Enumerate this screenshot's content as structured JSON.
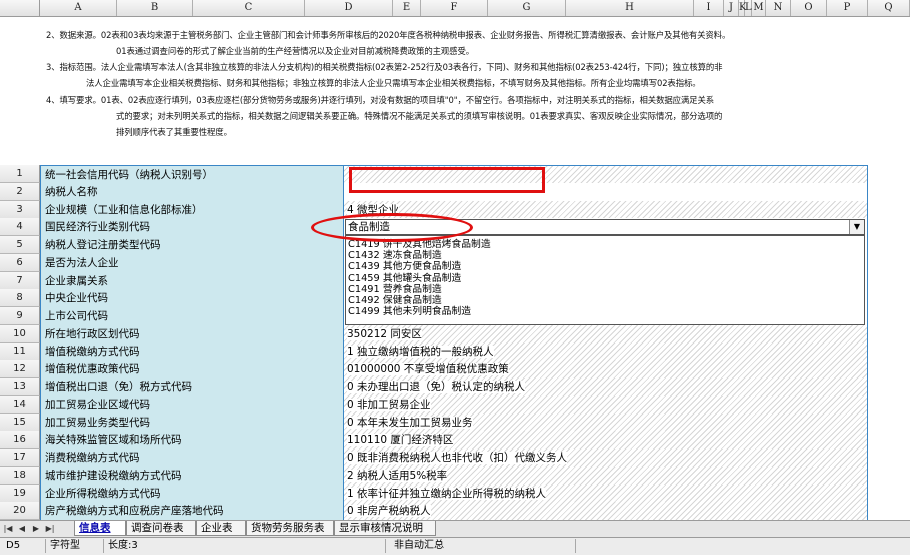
{
  "columns": [
    "A",
    "B",
    "C",
    "D",
    "E",
    "F",
    "G",
    "H",
    "I",
    "J",
    "K",
    "L",
    "M",
    "N",
    "O",
    "P",
    "Q"
  ],
  "notes": [
    "2、数据来源。02表和03表均来源于主管税务部门、企业主管部门和会计师事务所审核后的2020年度各税种纳税申报表、企业财务报告、所得税汇算清缴报表、会计账户及其他有关资料。",
    "01表通过调查问卷的形式了解企业当前的生产经营情况以及企业对目前减税降费政策的主观感受。",
    "3、指标范围。法人企业需填写本法人(含其非独立核算的非法人分支机构)的相关税费指标(02表第2-252行及03表各行，下同)、财务和其他指标(02表253-424行，下同)；独立核算的非",
    "法人企业需填写本企业相关税费指标、财务和其他指标；非独立核算的非法人企业只需填写本企业相关税费指标，不填写财务及其他指标。所有企业均需填写02表指标。",
    "4、填写要求。01表、02表应逐行填列，03表应逐栏(部分货物劳务或服务)并逐行填列，对没有数据的项目填\"0\"，不留空行。各项指标中，对注明关系式的指标，相关数据应满足关系",
    "式的要求；对未列明关系式的指标，相关数据之间逻辑关系要正确。特殊情况不能满足关系式的须填写审核说明。01表要求真实、客观反映企业实际情况，部分选项的",
    "排列顺序代表了其重要性程度。"
  ],
  "rows": [
    {
      "num": "1",
      "label": "统一社会信用代码（纳税人识别号）",
      "value": ""
    },
    {
      "num": "2",
      "label": "纳税人名称",
      "value": ""
    },
    {
      "num": "3",
      "label": "企业规模（工业和信息化部标准）",
      "value": "4  微型企业"
    },
    {
      "num": "4",
      "label": "国民经济行业类别代码",
      "value": ""
    },
    {
      "num": "5",
      "label": "纳税人登记注册类型代码",
      "value": ""
    },
    {
      "num": "6",
      "label": "是否为法人企业",
      "value": ""
    },
    {
      "num": "7",
      "label": "企业隶属关系",
      "value": ""
    },
    {
      "num": "8",
      "label": "中央企业代码",
      "value": ""
    },
    {
      "num": "9",
      "label": "上市公司代码",
      "value": ""
    },
    {
      "num": "10",
      "label": "所在地行政区划代码",
      "value": "350212  同安区"
    },
    {
      "num": "11",
      "label": "增值税缴纳方式代码",
      "value": "1  独立缴纳增值税的一般纳税人"
    },
    {
      "num": "12",
      "label": "增值税优惠政策代码",
      "value": "01000000  不享受增值税优惠政策"
    },
    {
      "num": "13",
      "label": "增值税出口退（免）税方式代码",
      "value": "0  未办理出口退（免）税认定的纳税人"
    },
    {
      "num": "14",
      "label": "加工贸易企业区域代码",
      "value": "0  非加工贸易企业"
    },
    {
      "num": "15",
      "label": "加工贸易业务类型代码",
      "value": "0  本年未发生加工贸易业务"
    },
    {
      "num": "16",
      "label": "海关特殊监管区域和场所代码",
      "value": "110110  厦门经济特区"
    },
    {
      "num": "17",
      "label": "消费税缴纳方式代码",
      "value": "0  既非消费税纳税人也非代收（扣）代缴义务人"
    },
    {
      "num": "18",
      "label": "城市维护建设税缴纳方式代码",
      "value": "2  纳税人适用5%税率"
    },
    {
      "num": "19",
      "label": "企业所得税缴纳方式代码",
      "value": "1  依率计征并独立缴纳企业所得税的纳税人"
    },
    {
      "num": "20",
      "label": "房产税缴纳方式和应税房产座落地代码",
      "value": "0  非房产税纳税人"
    }
  ],
  "combo": {
    "value": "食品制造"
  },
  "dropdown_options": [
    "C1419  饼干及其他焙烤食品制造",
    "C1432  速冻食品制造",
    "C1439  其他方便食品制造",
    "C1459  其他罐头食品制造",
    "C1491  营养食品制造",
    "C1492  保健食品制造",
    "C1499  其他未列明食品制造"
  ],
  "tabs": [
    "信息表",
    "调查问卷表",
    "企业表",
    "货物劳务服务表",
    "显示审核情况说明"
  ],
  "active_tab": 0,
  "status": {
    "cell": "D5",
    "type": "字符型",
    "length": "长度:3",
    "mode": "非自动汇总"
  },
  "colors": {
    "label_bg": "#cde8ee",
    "grid": "#3a86c6",
    "annotation": "#e01010"
  }
}
